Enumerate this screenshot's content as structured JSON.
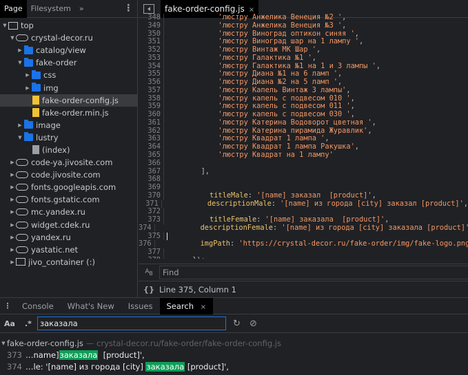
{
  "navigator": {
    "tabs": [
      "Page",
      "Filesystem"
    ],
    "more": "»",
    "tree": [
      {
        "label": "top",
        "level": 0,
        "arrow": "down",
        "icon": "frame-icon"
      },
      {
        "label": "crystal-decor.ru",
        "level": 1,
        "arrow": "down",
        "icon": "cloud-icon"
      },
      {
        "label": "catalog/view",
        "level": 2,
        "arrow": "right",
        "icon": "folder-icon"
      },
      {
        "label": "fake-order",
        "level": 2,
        "arrow": "down",
        "icon": "folder-icon"
      },
      {
        "label": "css",
        "level": 3,
        "arrow": "right",
        "icon": "folder-icon"
      },
      {
        "label": "img",
        "level": 3,
        "arrow": "right",
        "icon": "folder-icon"
      },
      {
        "label": "fake-order-config.js",
        "level": 3,
        "arrow": "",
        "icon": "js-file-icon",
        "selected": true
      },
      {
        "label": "fake-order.min.js",
        "level": 3,
        "arrow": "",
        "icon": "js-file-icon"
      },
      {
        "label": "image",
        "level": 2,
        "arrow": "right",
        "icon": "folder-icon"
      },
      {
        "label": "lustry",
        "level": 2,
        "arrow": "down",
        "icon": "folder-icon"
      },
      {
        "label": "(index)",
        "level": 3,
        "arrow": "",
        "icon": "document-icon"
      },
      {
        "label": "code-ya.jivosite.com",
        "level": 1,
        "arrow": "right",
        "icon": "cloud-icon"
      },
      {
        "label": "code.jivosite.com",
        "level": 1,
        "arrow": "right",
        "icon": "cloud-icon"
      },
      {
        "label": "fonts.googleapis.com",
        "level": 1,
        "arrow": "right",
        "icon": "cloud-icon"
      },
      {
        "label": "fonts.gstatic.com",
        "level": 1,
        "arrow": "right",
        "icon": "cloud-icon"
      },
      {
        "label": "mc.yandex.ru",
        "level": 1,
        "arrow": "right",
        "icon": "cloud-icon"
      },
      {
        "label": "widget.cdek.ru",
        "level": 1,
        "arrow": "right",
        "icon": "cloud-icon"
      },
      {
        "label": "yandex.ru",
        "level": 1,
        "arrow": "right",
        "icon": "cloud-icon"
      },
      {
        "label": "yastatic.net",
        "level": 1,
        "arrow": "right",
        "icon": "cloud-icon"
      },
      {
        "label": "jivo_container (:)",
        "level": 1,
        "arrow": "right",
        "icon": "frame-icon"
      }
    ]
  },
  "editor": {
    "tab": "fake-order-config.js",
    "close": "×",
    "lines": [
      {
        "n": "348",
        "parts": [
          [
            "s",
            "            'люстру Анжелика Венеция №2 '"
          ],
          [
            "o",
            ","
          ]
        ]
      },
      {
        "n": "349",
        "parts": [
          [
            "s",
            "            'люстру Анжелика Венеция №3 '"
          ],
          [
            "o",
            ","
          ]
        ]
      },
      {
        "n": "350",
        "parts": [
          [
            "s",
            "            'люстру Виноград оптикон синяя '"
          ],
          [
            "o",
            ","
          ]
        ]
      },
      {
        "n": "351",
        "parts": [
          [
            "s",
            "            'люстру Виноград шар на 1 лампу '"
          ],
          [
            "o",
            ","
          ]
        ]
      },
      {
        "n": "352",
        "parts": [
          [
            "s",
            "            'люстру Винтаж МК Шар '"
          ],
          [
            "o",
            ","
          ]
        ]
      },
      {
        "n": "353",
        "parts": [
          [
            "s",
            "            'люстру Галактика №1 '"
          ],
          [
            "o",
            ","
          ]
        ]
      },
      {
        "n": "354",
        "parts": [
          [
            "s",
            "            'люстру Галактика №1 на 1 и 3 лампы '"
          ],
          [
            "o",
            ","
          ]
        ]
      },
      {
        "n": "355",
        "parts": [
          [
            "s",
            "            'люстру Диана №1 на 6 ламп '"
          ],
          [
            "o",
            ","
          ]
        ]
      },
      {
        "n": "356",
        "parts": [
          [
            "s",
            "            'люстру Диана №2 на 5 ламп '"
          ],
          [
            "o",
            ","
          ]
        ]
      },
      {
        "n": "357",
        "parts": [
          [
            "s",
            "            'люстру Капель Винтаж 3 лампы'"
          ],
          [
            "o",
            ","
          ]
        ]
      },
      {
        "n": "358",
        "parts": [
          [
            "s",
            "            'люстру капель с подвесом 010 '"
          ],
          [
            "o",
            ","
          ]
        ]
      },
      {
        "n": "359",
        "parts": [
          [
            "s",
            "            'люстру капель с подвесом 011 '"
          ],
          [
            "o",
            ","
          ]
        ]
      },
      {
        "n": "360",
        "parts": [
          [
            "s",
            "            'люстру капель с подвесом 030 '"
          ],
          [
            "o",
            ","
          ]
        ]
      },
      {
        "n": "361",
        "parts": [
          [
            "s",
            "            'люстру Катерина Водоворот цветная '"
          ],
          [
            "o",
            ","
          ]
        ]
      },
      {
        "n": "362",
        "parts": [
          [
            "s",
            "            'люстру Катерина пирамида Журавлик'"
          ],
          [
            "o",
            ","
          ]
        ]
      },
      {
        "n": "363",
        "parts": [
          [
            "s",
            "            'люстру Квадрат 1 лампа '"
          ],
          [
            "o",
            ","
          ]
        ]
      },
      {
        "n": "364",
        "parts": [
          [
            "s",
            "            'люстру Квадрат 1 лампа Ракушка'"
          ],
          [
            "o",
            ","
          ]
        ]
      },
      {
        "n": "365",
        "parts": [
          [
            "s",
            "            'люстру Квадрат на 1 лампу'"
          ]
        ]
      },
      {
        "n": "366",
        "parts": []
      },
      {
        "n": "367",
        "parts": [
          [
            "o",
            "        ],"
          ]
        ]
      },
      {
        "n": "368",
        "parts": []
      },
      {
        "n": "369",
        "parts": []
      },
      {
        "n": "370",
        "parts": [
          [
            "p",
            "          titleMale"
          ],
          [
            "o",
            ": "
          ],
          [
            "s",
            "'[name] заказал  [product]'"
          ],
          [
            "o",
            ","
          ]
        ]
      },
      {
        "n": "371",
        "parts": [
          [
            "p",
            "          descriptionMale"
          ],
          [
            "o",
            ": "
          ],
          [
            "s",
            "'[name] из города [city] заказал [product]'"
          ],
          [
            "o",
            ","
          ]
        ]
      },
      {
        "n": "372",
        "parts": []
      },
      {
        "n": "373",
        "parts": [
          [
            "p",
            "          titleFemale"
          ],
          [
            "o",
            ": "
          ],
          [
            "s",
            "'[name] заказала  [product]'"
          ],
          [
            "o",
            ","
          ]
        ]
      },
      {
        "n": "374",
        "parts": [
          [
            "p",
            "          descriptionFemale"
          ],
          [
            "o",
            ": "
          ],
          [
            "s",
            "'[name] из города [city] заказала [product]'"
          ],
          [
            "o",
            ","
          ]
        ]
      },
      {
        "n": "375",
        "parts": []
      },
      {
        "n": "376",
        "parts": [
          [
            "p",
            "          imgPath"
          ],
          [
            "o",
            ": "
          ],
          [
            "s",
            "'https://crystal-decor.ru/fake-order/img/fake-logo.png'"
          ],
          [
            "o",
            ","
          ]
        ]
      },
      {
        "n": "377",
        "parts": []
      },
      {
        "n": "378",
        "parts": [
          [
            "o",
            "      });"
          ]
        ]
      }
    ],
    "find_placeholder": "Find",
    "status": "Line 375, Column 1"
  },
  "drawer": {
    "tabs": [
      "Console",
      "What's New",
      "Issues",
      "Search"
    ],
    "active": "Search",
    "close": "×",
    "search": {
      "case_label": "Aa",
      "regex_label": ".*",
      "query": "заказала"
    },
    "results": {
      "file": "fake-order-config.js",
      "path": "— crystal-decor.ru/fake-order/fake-order-config.js",
      "matches": [
        {
          "line": "373",
          "before": "…name] ",
          "match": "заказала",
          "after": "  [product]',"
        },
        {
          "line": "374",
          "before": "…le: '[name] из города [city] ",
          "match": "заказала",
          "after": " [product]',"
        }
      ]
    }
  },
  "colors": {
    "string": "#f29766",
    "property": "#e8c16b",
    "highlight": "#0f9d58",
    "accent": "#1a73e8"
  }
}
